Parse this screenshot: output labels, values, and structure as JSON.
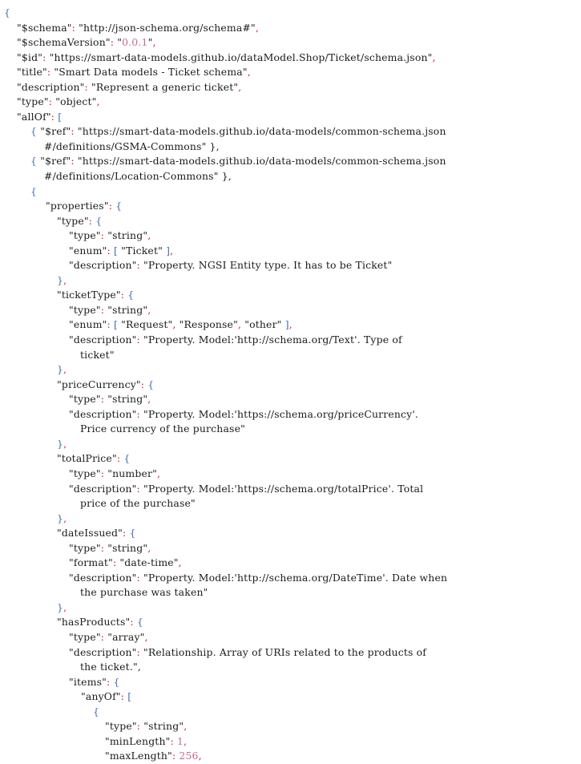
{
  "document": {
    "kind": "json-schema-code-listing",
    "schema_title": "Smart Data models - Ticket schema",
    "colors": {
      "text": "#1a1a1a",
      "punctuation": "#c02020",
      "brace": "#4170b0",
      "number": "#c86a92",
      "background": "#ffffff"
    }
  },
  "lines": [
    {
      "indent": 0,
      "text": "{"
    },
    {
      "indent": 1,
      "text": "\"$schema\": \"http://json-schema.org/schema#\","
    },
    {
      "indent": 1,
      "text": "\"$schemaVersion\": \"0.0.1\","
    },
    {
      "indent": 1,
      "text": "\"$id\": \"https://smart-data-models.github.io/dataModel.Shop/Ticket/schema.json\","
    },
    {
      "indent": 1,
      "text": "\"title\": \"Smart Data models - Ticket schema\","
    },
    {
      "indent": 1,
      "text": "\"description\": \"Represent a generic ticket\","
    },
    {
      "indent": 1,
      "text": "\"type\": \"object\","
    },
    {
      "indent": 1,
      "text": "\"allOf\": ["
    },
    {
      "indent": 2,
      "text": "{ \"$ref\": \"https://smart-data-models.github.io/data-models/common-schema.json"
    },
    {
      "cont": 1,
      "text": "#/definitions/GSMA-Commons\" },"
    },
    {
      "indent": 2,
      "text": "{ \"$ref\": \"https://smart-data-models.github.io/data-models/common-schema.json"
    },
    {
      "cont": 1,
      "text": "#/definitions/Location-Commons\" },"
    },
    {
      "indent": 2,
      "text": "{"
    },
    {
      "indent": 3,
      "text": "\"properties\": {"
    },
    {
      "indent": 4,
      "text": "\"type\": {"
    },
    {
      "indent": 5,
      "text": "\"type\": \"string\","
    },
    {
      "indent": 5,
      "text": "\"enum\": [ \"Ticket\" ],"
    },
    {
      "indent": 5,
      "text": "\"description\": \"Property. NGSI Entity type. It has to be Ticket\""
    },
    {
      "indent": 4,
      "text": "},"
    },
    {
      "indent": 4,
      "text": "\"ticketType\": {"
    },
    {
      "indent": 5,
      "text": "\"type\": \"string\","
    },
    {
      "indent": 5,
      "text": "\"enum\": [ \"Request\", \"Response\", \"other\" ],"
    },
    {
      "indent": 5,
      "text": "\"description\": \"Property. Model:'http://schema.org/Text'. Type of"
    },
    {
      "cont": 2,
      "text": "ticket\""
    },
    {
      "indent": 4,
      "text": "},"
    },
    {
      "indent": 4,
      "text": "\"priceCurrency\": {"
    },
    {
      "indent": 5,
      "text": "\"type\": \"string\","
    },
    {
      "indent": 5,
      "text": "\"description\": \"Property. Model:'https://schema.org/priceCurrency'."
    },
    {
      "cont": 2,
      "text": "Price currency of the purchase\""
    },
    {
      "indent": 4,
      "text": "},"
    },
    {
      "indent": 4,
      "text": "\"totalPrice\": {"
    },
    {
      "indent": 5,
      "text": "\"type\": \"number\","
    },
    {
      "indent": 5,
      "text": "\"description\": \"Property. Model:'https://schema.org/totalPrice'. Total"
    },
    {
      "cont": 2,
      "text": "price of the purchase\""
    },
    {
      "indent": 4,
      "text": "},"
    },
    {
      "indent": 4,
      "text": "\"dateIssued\": {"
    },
    {
      "indent": 5,
      "text": "\"type\": \"string\","
    },
    {
      "indent": 5,
      "text": "\"format\": \"date-time\","
    },
    {
      "indent": 5,
      "text": "\"description\": \"Property. Model:'http://schema.org/DateTime'. Date when"
    },
    {
      "cont": 2,
      "text": "the purchase was taken\""
    },
    {
      "indent": 4,
      "text": "},"
    },
    {
      "indent": 4,
      "text": "\"hasProducts\": {"
    },
    {
      "indent": 5,
      "text": "\"type\": \"array\","
    },
    {
      "indent": 5,
      "text": "\"description\": \"Relationship. Array of URIs related to the products of"
    },
    {
      "cont": 2,
      "text": "the ticket.\","
    },
    {
      "indent": 5,
      "text": "\"items\": {"
    },
    {
      "indent": 6,
      "text": "\"anyOf\": ["
    },
    {
      "indent": 7,
      "text": "{"
    },
    {
      "indent": 8,
      "text": "\"type\": \"string\","
    },
    {
      "indent": 8,
      "text": "\"minLength\": 1,"
    },
    {
      "indent": 8,
      "text": "\"maxLength\": 256,"
    }
  ]
}
